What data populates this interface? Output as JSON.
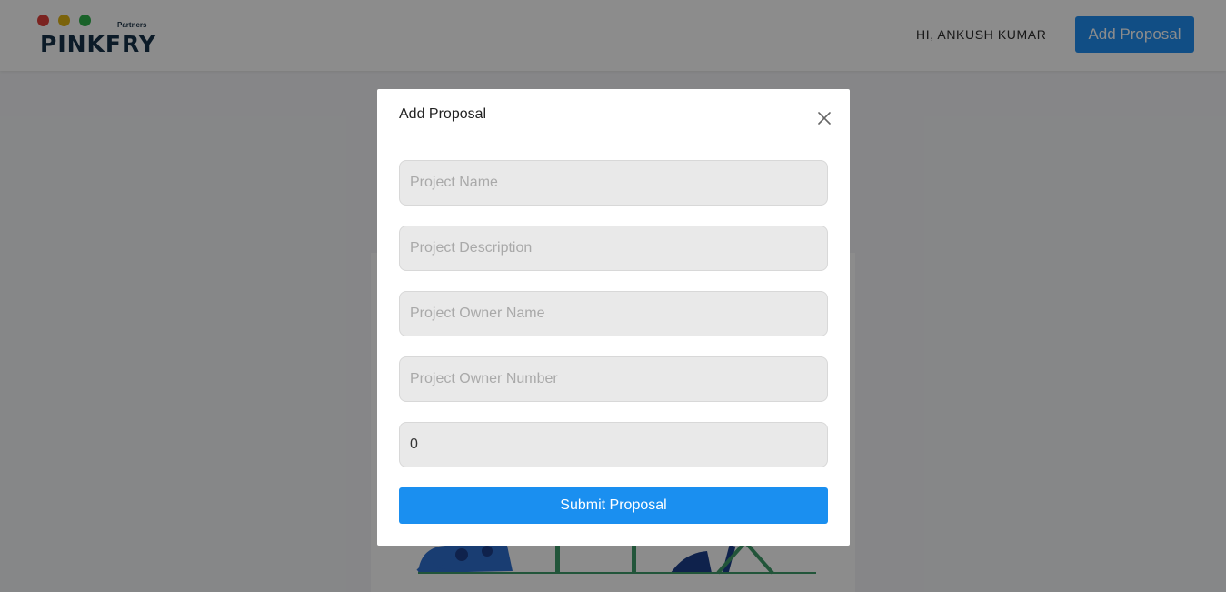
{
  "header": {
    "logo_partners": "Partners",
    "logo_brand": "PINKFRY",
    "logo_dot_colors": [
      "#e0413b",
      "#e0b414",
      "#2eb24c"
    ],
    "greeting": "HI, ANKUSH KUMAR",
    "add_proposal_label": "Add Proposal"
  },
  "modal": {
    "title": "Add Proposal",
    "close_icon": "close-icon",
    "fields": [
      {
        "placeholder": "Project Name",
        "value": ""
      },
      {
        "placeholder": "Project Description",
        "value": ""
      },
      {
        "placeholder": "Project Owner Name",
        "value": ""
      },
      {
        "placeholder": "Project Owner Number",
        "value": ""
      },
      {
        "placeholder": "",
        "value": "0"
      }
    ],
    "submit_label": "Submit Proposal"
  },
  "colors": {
    "accent": "#1a8ff0",
    "overlay": "rgba(0,0,0,0.45)"
  }
}
